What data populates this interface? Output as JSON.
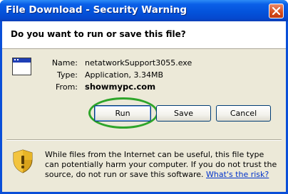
{
  "window": {
    "title": "File Download - Security Warning"
  },
  "dialog": {
    "question": "Do you want to run or save this file?",
    "file_info": {
      "name_label": "Name:",
      "name_value": "netatworkSupport3055.exe",
      "type_label": "Type:",
      "type_value": "Application, 3.34MB",
      "from_label": "From:",
      "from_value": "showmypc.com"
    },
    "buttons": {
      "run": "Run",
      "save": "Save",
      "cancel": "Cancel"
    },
    "warning": {
      "text": "While files from the Internet can be useful, this file type can potentially harm your computer. If you do not trust the source, do not run or save this software.",
      "link": "What's the risk?"
    }
  },
  "icons": {
    "close": "close-icon",
    "app": "application-icon",
    "shield": "shield-warning-icon"
  },
  "colors": {
    "titlebar": "#0453db",
    "highlight_ring": "#2ea52a",
    "link": "#0033cc"
  }
}
